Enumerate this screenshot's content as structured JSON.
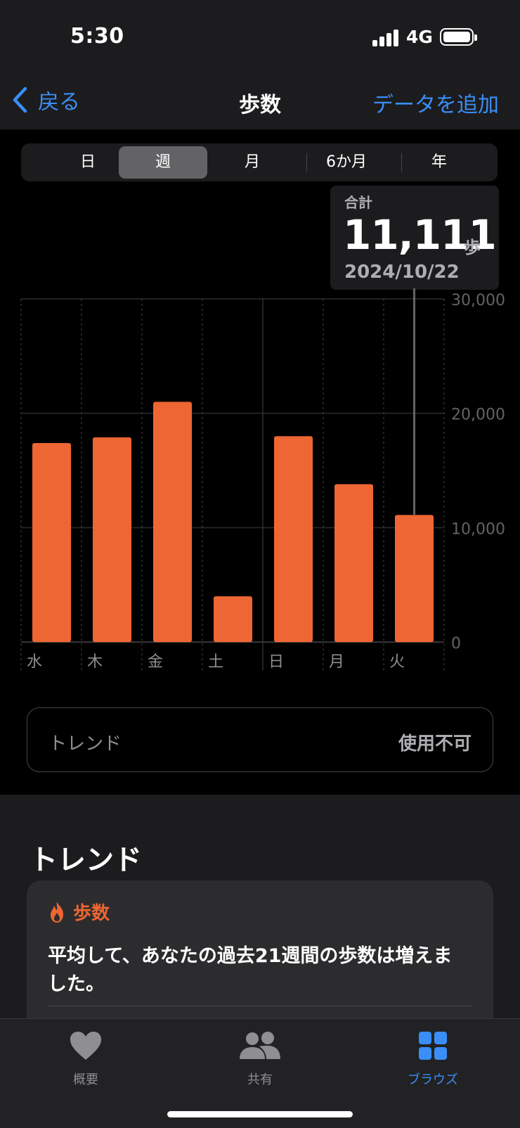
{
  "status": {
    "time": "5:30",
    "network": "4G"
  },
  "nav": {
    "back": "戻る",
    "title": "歩数",
    "action": "データを追加"
  },
  "segments": [
    "日",
    "週",
    "月",
    "6か月",
    "年"
  ],
  "selected_segment": "週",
  "tooltip": {
    "label": "合計",
    "value": "11,111",
    "unit": "歩",
    "date": "2024/10/22"
  },
  "chart_data": {
    "type": "bar",
    "categories": [
      "水",
      "木",
      "金",
      "土",
      "日",
      "月",
      "火"
    ],
    "values": [
      17400,
      17900,
      21000,
      4000,
      18000,
      13800,
      11111
    ],
    "ylim": [
      0,
      30000
    ],
    "yticks": [
      "0",
      "10,000",
      "20,000",
      "30,000"
    ],
    "ytick_values": [
      0,
      10000,
      20000,
      30000
    ],
    "selected_index": 6,
    "bar_color": "#ee6633",
    "grid": true
  },
  "trend_row": {
    "label": "トレンド",
    "value": "使用不可"
  },
  "trends": {
    "section_title": "トレンド",
    "card": {
      "category": "歩数",
      "text": "平均して、あなたの過去21週間の歩数は増えました。"
    }
  },
  "tabs": [
    {
      "label": "概要",
      "icon": "heart-icon"
    },
    {
      "label": "共有",
      "icon": "people-icon"
    },
    {
      "label": "ブラウズ",
      "icon": "grid-icon"
    }
  ],
  "colors": {
    "accent": "#3a8ef6",
    "bar": "#ee6633"
  }
}
